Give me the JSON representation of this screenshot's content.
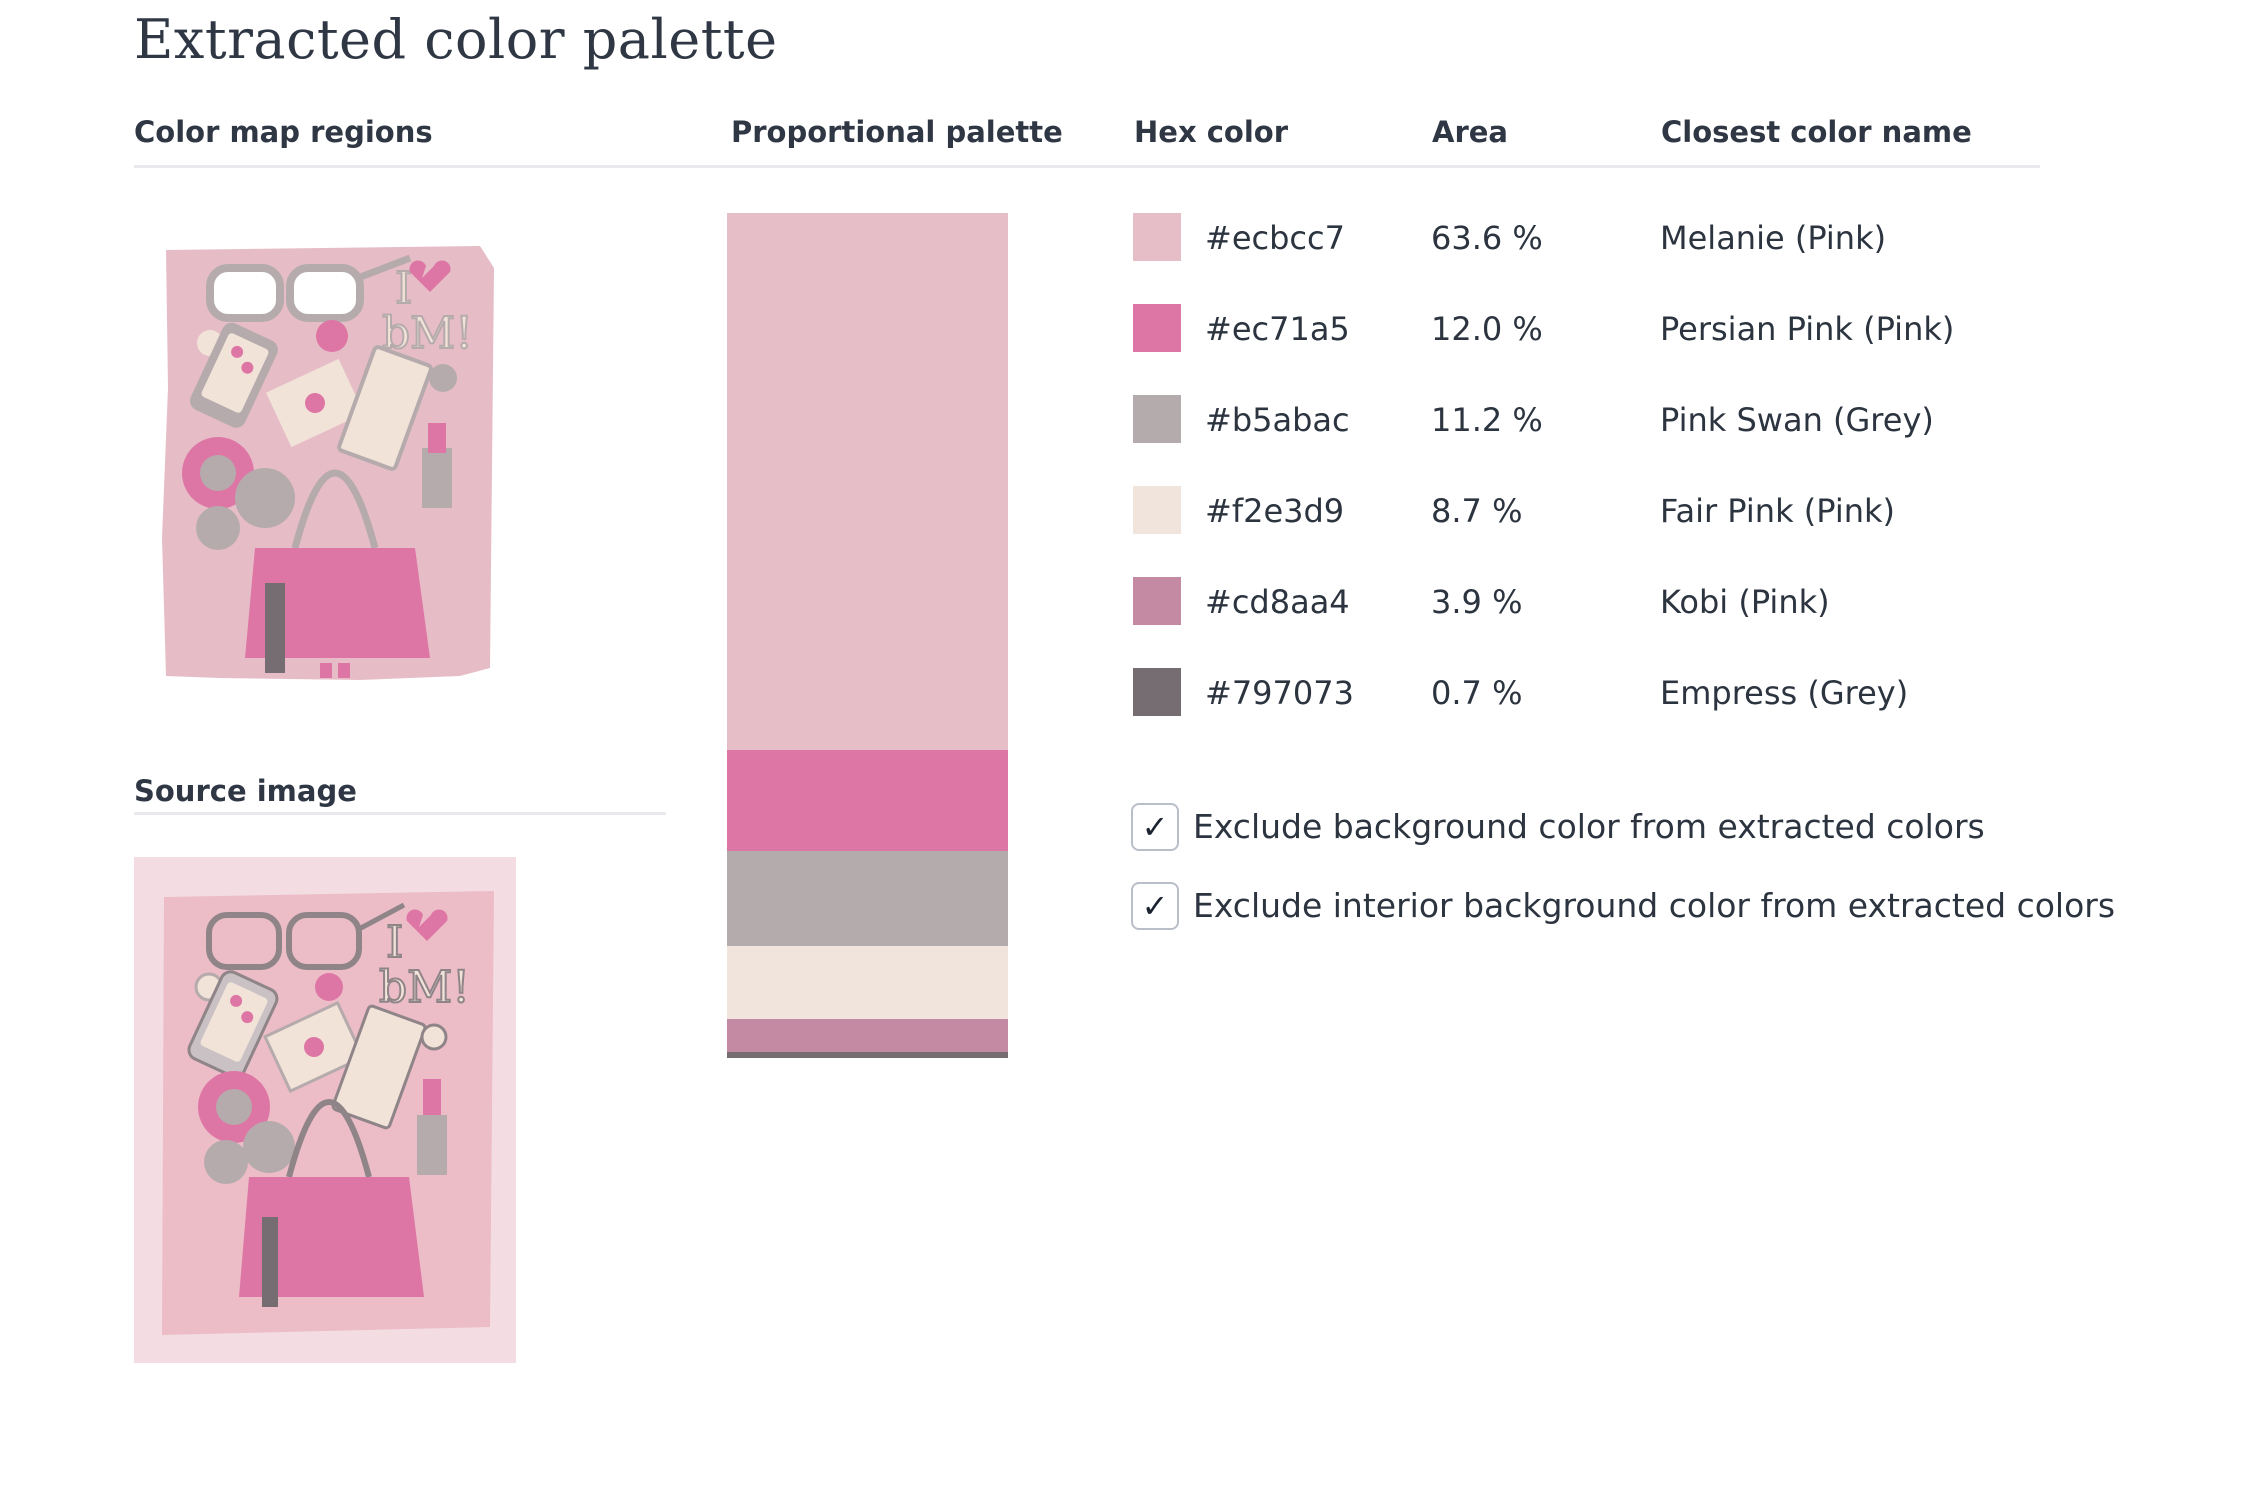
{
  "page": {
    "title": "Extracted color palette"
  },
  "headers": {
    "color_map": "Color map regions",
    "palette": "Proportional palette",
    "hex": "Hex color",
    "area": "Area",
    "name": "Closest color name",
    "source": "Source image"
  },
  "colors": [
    {
      "hex": "#ecbcc7",
      "area": "63.6 %",
      "fraction": 0.636,
      "name": "Melanie (Pink)",
      "swatch": "#e5bec8"
    },
    {
      "hex": "#ec71a5",
      "area": "12.0 %",
      "fraction": 0.12,
      "name": "Persian Pink (Pink)",
      "swatch": "#de76a5"
    },
    {
      "hex": "#b5abac",
      "area": "11.2 %",
      "fraction": 0.112,
      "name": "Pink Swan (Grey)",
      "swatch": "#b4abad"
    },
    {
      "hex": "#f2e3d9",
      "area": "8.7 %",
      "fraction": 0.087,
      "name": "Fair Pink (Pink)",
      "swatch": "#f1e4dc"
    },
    {
      "hex": "#cd8aa4",
      "area": "3.9 %",
      "fraction": 0.039,
      "name": "Kobi (Pink)",
      "swatch": "#c58aa3"
    },
    {
      "hex": "#797073",
      "area": "0.7 %",
      "fraction": 0.007,
      "name": "Empress (Grey)",
      "swatch": "#766d72"
    }
  ],
  "options": [
    {
      "label": "Exclude background color from extracted colors",
      "checked": true,
      "mark": "✓"
    },
    {
      "label": "Exclude interior background color from extracted colors",
      "checked": true,
      "mark": "✓"
    }
  ]
}
